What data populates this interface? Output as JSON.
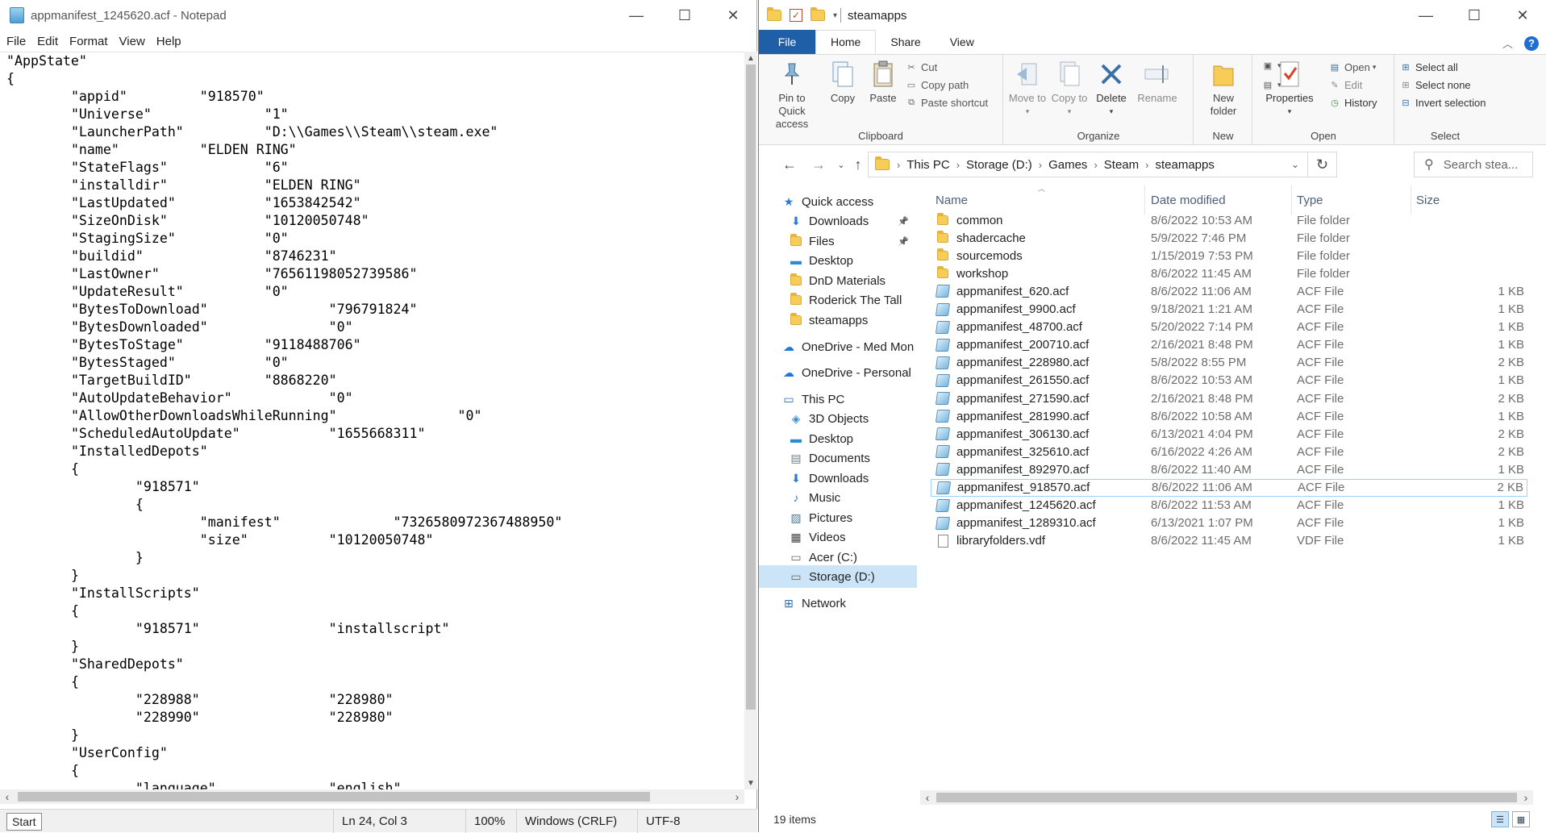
{
  "notepad": {
    "title": "appmanifest_1245620.acf - Notepad",
    "menu": [
      "File",
      "Edit",
      "Format",
      "View",
      "Help"
    ],
    "content": "\"AppState\"\n{\n\t\"appid\"\t\t\"918570\"\n\t\"Universe\"\t\t\"1\"\n\t\"LauncherPath\"\t\t\"D:\\\\Games\\\\Steam\\\\steam.exe\"\n\t\"name\"\t\t\"ELDEN RING\"\n\t\"StateFlags\"\t\t\"6\"\n\t\"installdir\"\t\t\"ELDEN RING\"\n\t\"LastUpdated\"\t\t\"1653842542\"\n\t\"SizeOnDisk\"\t\t\"10120050748\"\n\t\"StagingSize\"\t\t\"0\"\n\t\"buildid\"\t\t\"8746231\"\n\t\"LastOwner\"\t\t\"76561198052739586\"\n\t\"UpdateResult\"\t\t\"0\"\n\t\"BytesToDownload\"\t\t\"796791824\"\n\t\"BytesDownloaded\"\t\t\"0\"\n\t\"BytesToStage\"\t\t\"9118488706\"\n\t\"BytesStaged\"\t\t\"0\"\n\t\"TargetBuildID\"\t\t\"8868220\"\n\t\"AutoUpdateBehavior\"\t\t\"0\"\n\t\"AllowOtherDownloadsWhileRunning\"\t\t\"0\"\n\t\"ScheduledAutoUpdate\"\t\t\"1655668311\"\n\t\"InstalledDepots\"\n\t{\n\t\t\"918571\"\n\t\t{\n\t\t\t\"manifest\"\t\t\"7326580972367488950\"\n\t\t\t\"size\"\t\t\"10120050748\"\n\t\t}\n\t}\n\t\"InstallScripts\"\n\t{\n\t\t\"918571\"\t\t\"installscript\"\n\t}\n\t\"SharedDepots\"\n\t{\n\t\t\"228988\"\t\t\"228980\"\n\t\t\"228990\"\t\t\"228980\"\n\t}\n\t\"UserConfig\"\n\t{\n\t\t\"language\"\t\t\"english\"",
    "status": {
      "start": "Start",
      "position": "Ln 24, Col 3",
      "zoom": "100%",
      "line_ending": "Windows (CRLF)",
      "encoding": "UTF-8"
    }
  },
  "explorer": {
    "title": "steamapps",
    "tabs": [
      "File",
      "Home",
      "Share",
      "View"
    ],
    "ribbon": {
      "clipboard": {
        "label": "Clipboard",
        "pin": "Pin to Quick access",
        "copy": "Copy",
        "paste": "Paste",
        "cut": "Cut",
        "copy_path": "Copy path",
        "paste_shortcut": "Paste shortcut"
      },
      "organize": {
        "label": "Organize",
        "move_to": "Move to",
        "copy_to": "Copy to",
        "delete": "Delete",
        "rename": "Rename"
      },
      "new": {
        "label": "New",
        "new_folder": "New folder"
      },
      "open": {
        "label": "Open",
        "properties": "Properties",
        "open": "Open",
        "edit": "Edit",
        "history": "History"
      },
      "select": {
        "label": "Select",
        "select_all": "Select all",
        "select_none": "Select none",
        "invert": "Invert selection"
      }
    },
    "breadcrumb": [
      "This PC",
      "Storage (D:)",
      "Games",
      "Steam",
      "steamapps"
    ],
    "search_placeholder": "Search stea...",
    "nav": [
      {
        "label": "Quick access",
        "icon": "star-icon",
        "indent": 1
      },
      {
        "label": "Downloads",
        "icon": "download-arrow-icon",
        "indent": 2,
        "pinned": true
      },
      {
        "label": "Files",
        "icon": "folder-icon",
        "indent": 2,
        "pinned": true
      },
      {
        "label": "Desktop",
        "icon": "desktop-icon",
        "indent": 2
      },
      {
        "label": "DnD Materials",
        "icon": "folder-icon",
        "indent": 2
      },
      {
        "label": "Roderick The Tall",
        "icon": "folder-icon",
        "indent": 2
      },
      {
        "label": "steamapps",
        "icon": "folder-icon",
        "indent": 2
      },
      {
        "label": "OneDrive - Med Mon",
        "icon": "cloud-icon",
        "indent": 1
      },
      {
        "label": "OneDrive - Personal",
        "icon": "cloud-icon",
        "indent": 1
      },
      {
        "label": "This PC",
        "icon": "pc-icon",
        "indent": 1
      },
      {
        "label": "3D Objects",
        "icon": "cube-icon",
        "indent": 2
      },
      {
        "label": "Desktop",
        "icon": "desktop-icon",
        "indent": 2
      },
      {
        "label": "Documents",
        "icon": "documents-icon",
        "indent": 2
      },
      {
        "label": "Downloads",
        "icon": "download-arrow-icon",
        "indent": 2
      },
      {
        "label": "Music",
        "icon": "music-note-icon",
        "indent": 2
      },
      {
        "label": "Pictures",
        "icon": "pictures-icon",
        "indent": 2
      },
      {
        "label": "Videos",
        "icon": "film-icon",
        "indent": 2
      },
      {
        "label": "Acer (C:)",
        "icon": "drive-icon",
        "indent": 2
      },
      {
        "label": "Storage (D:)",
        "icon": "drive-icon",
        "indent": 2,
        "selected": true
      },
      {
        "label": "Network",
        "icon": "network-icon",
        "indent": 1
      }
    ],
    "columns": {
      "name": "Name",
      "date": "Date modified",
      "type": "Type",
      "size": "Size"
    },
    "files": [
      {
        "name": "common",
        "date": "8/6/2022 10:53 AM",
        "type": "File folder",
        "size": "",
        "kind": "folder"
      },
      {
        "name": "shadercache",
        "date": "5/9/2022 7:46 PM",
        "type": "File folder",
        "size": "",
        "kind": "folder"
      },
      {
        "name": "sourcemods",
        "date": "1/15/2019 7:53 PM",
        "type": "File folder",
        "size": "",
        "kind": "folder"
      },
      {
        "name": "workshop",
        "date": "8/6/2022 11:45 AM",
        "type": "File folder",
        "size": "",
        "kind": "folder"
      },
      {
        "name": "appmanifest_620.acf",
        "date": "8/6/2022 11:06 AM",
        "type": "ACF File",
        "size": "1 KB",
        "kind": "acf"
      },
      {
        "name": "appmanifest_9900.acf",
        "date": "9/18/2021 1:21 AM",
        "type": "ACF File",
        "size": "1 KB",
        "kind": "acf"
      },
      {
        "name": "appmanifest_48700.acf",
        "date": "5/20/2022 7:14 PM",
        "type": "ACF File",
        "size": "1 KB",
        "kind": "acf"
      },
      {
        "name": "appmanifest_200710.acf",
        "date": "2/16/2021 8:48 PM",
        "type": "ACF File",
        "size": "1 KB",
        "kind": "acf"
      },
      {
        "name": "appmanifest_228980.acf",
        "date": "5/8/2022 8:55 PM",
        "type": "ACF File",
        "size": "2 KB",
        "kind": "acf"
      },
      {
        "name": "appmanifest_261550.acf",
        "date": "8/6/2022 10:53 AM",
        "type": "ACF File",
        "size": "1 KB",
        "kind": "acf"
      },
      {
        "name": "appmanifest_271590.acf",
        "date": "2/16/2021 8:48 PM",
        "type": "ACF File",
        "size": "2 KB",
        "kind": "acf"
      },
      {
        "name": "appmanifest_281990.acf",
        "date": "8/6/2022 10:58 AM",
        "type": "ACF File",
        "size": "1 KB",
        "kind": "acf"
      },
      {
        "name": "appmanifest_306130.acf",
        "date": "6/13/2021 4:04 PM",
        "type": "ACF File",
        "size": "2 KB",
        "kind": "acf"
      },
      {
        "name": "appmanifest_325610.acf",
        "date": "6/16/2022 4:26 AM",
        "type": "ACF File",
        "size": "2 KB",
        "kind": "acf"
      },
      {
        "name": "appmanifest_892970.acf",
        "date": "8/6/2022 11:40 AM",
        "type": "ACF File",
        "size": "1 KB",
        "kind": "acf"
      },
      {
        "name": "appmanifest_918570.acf",
        "date": "8/6/2022 11:06 AM",
        "type": "ACF File",
        "size": "2 KB",
        "kind": "acf",
        "selected": true
      },
      {
        "name": "appmanifest_1245620.acf",
        "date": "8/6/2022 11:53 AM",
        "type": "ACF File",
        "size": "1 KB",
        "kind": "acf"
      },
      {
        "name": "appmanifest_1289310.acf",
        "date": "6/13/2021 1:07 PM",
        "type": "ACF File",
        "size": "1 KB",
        "kind": "acf"
      },
      {
        "name": "libraryfolders.vdf",
        "date": "8/6/2022 11:45 AM",
        "type": "VDF File",
        "size": "1 KB",
        "kind": "vdf"
      }
    ],
    "status": "19 items"
  }
}
